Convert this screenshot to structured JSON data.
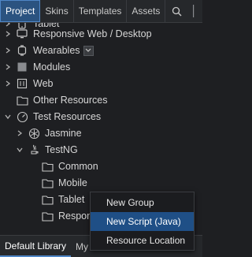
{
  "tabs": [
    {
      "label": "Project",
      "active": true
    },
    {
      "label": "Skins",
      "active": false
    },
    {
      "label": "Templates",
      "active": false
    },
    {
      "label": "Assets",
      "active": false
    }
  ],
  "toolbar": {
    "search_icon": "search-icon",
    "more_icon": "vertical-divider"
  },
  "tree": [
    {
      "label": "Tablet",
      "icon": "tablet-icon",
      "chevron": "right",
      "level": 0
    },
    {
      "label": "Responsive Web / Desktop",
      "icon": "monitor-icon",
      "chevron": "right",
      "level": 0
    },
    {
      "label": "Wearables",
      "icon": "watch-icon",
      "chevron": "right",
      "level": 0
    },
    {
      "label": "Modules",
      "icon": "module-icon",
      "chevron": "right",
      "level": 0
    },
    {
      "label": "Web",
      "icon": "grid-icon",
      "chevron": "right",
      "level": 0
    },
    {
      "label": "Other Resources",
      "icon": "folder-icon",
      "chevron": "none",
      "level": 0
    },
    {
      "label": "Test Resources",
      "icon": "gauge-icon",
      "chevron": "down",
      "level": 0
    },
    {
      "label": "Jasmine",
      "icon": "jasmine-icon",
      "chevron": "right",
      "level": 1
    },
    {
      "label": "TestNG",
      "icon": "java-icon",
      "chevron": "down",
      "level": 1
    },
    {
      "label": "Common",
      "icon": "folder-icon",
      "chevron": "none",
      "level": 2
    },
    {
      "label": "Mobile",
      "icon": "folder-icon",
      "chevron": "none",
      "level": 2
    },
    {
      "label": "Tablet",
      "icon": "folder-icon",
      "chevron": "none",
      "level": 2
    },
    {
      "label": "Respon",
      "icon": "folder-icon",
      "chevron": "none",
      "level": 2
    }
  ],
  "bottom": {
    "tab1": "Default Library",
    "tab2": "My"
  },
  "menu": [
    {
      "label": "New Group",
      "highlighted": false
    },
    {
      "label": "New Script (Java)",
      "highlighted": true
    },
    {
      "label": "Resource Location",
      "highlighted": false
    }
  ],
  "colors": {
    "accent": "#2b5380",
    "menu_highlight": "#1f4f86",
    "background": "#1e1f22"
  }
}
